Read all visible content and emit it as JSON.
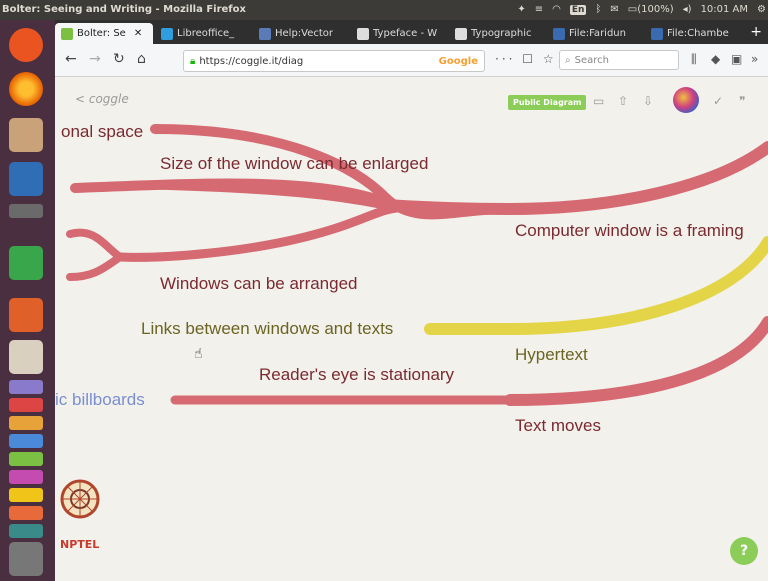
{
  "window_title": "Bolter: Seeing and Writing - Mozilla Firefox",
  "system_tray": {
    "keyboard": "En",
    "battery": "(100%)",
    "clock": "10:01 AM"
  },
  "tabs": [
    {
      "label": "Bolter: Se",
      "close": "✕"
    },
    {
      "label": "Libreoffice_"
    },
    {
      "label": "Help:Vector"
    },
    {
      "label": "Typeface - W"
    },
    {
      "label": "Typographic"
    },
    {
      "label": "File:Faridun"
    },
    {
      "label": "File:Chambe"
    }
  ],
  "new_tab": "+",
  "nav": {
    "url": "https://coggle.it/diag",
    "search_engine": "Google",
    "search_placeholder": "Search",
    "page_actions": "··· ☐ ☆"
  },
  "coggle": {
    "back_label": "< coggle",
    "public_badge": "Public Diagram",
    "help_label": "?"
  },
  "mindmap": {
    "nodes": {
      "frame": "Computer window is a framing",
      "hypertext": "Hypertext",
      "text_moves": "Text moves",
      "dimensional": "onal space",
      "enlarged": "Size of the window can be enlarged",
      "arranged": "Windows can be arranged",
      "links": "Links between windows and texts",
      "stationary": "Reader's eye is stationary",
      "billboards": "ic billboards"
    },
    "colors": {
      "branch_red": "#d66a72",
      "branch_yellow": "#e4d447",
      "text_red": "#7a2a30",
      "text_olive": "#6b6422",
      "text_blue": "#7a8fd0"
    }
  },
  "nptel_label": "NPTEL"
}
